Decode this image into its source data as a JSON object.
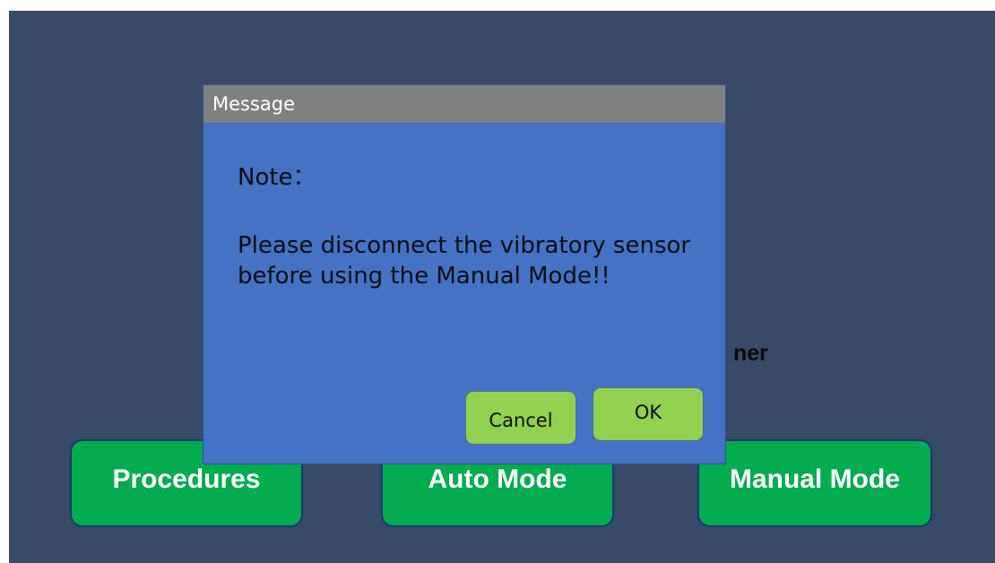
{
  "background": {
    "partial_text": "ner"
  },
  "mode_buttons": {
    "procedures": "Procedures",
    "auto": "Auto Mode",
    "manual": "Manual Mode"
  },
  "dialog": {
    "title": "Message",
    "note_label": "Note：",
    "message": "Please disconnect the vibratory sensor before using the Manual Mode!!",
    "cancel_label": "Cancel",
    "ok_label": "OK"
  },
  "colors": {
    "screen_background": "#374a68",
    "dialog_body": "#4472c4",
    "dialog_titlebar": "#808080",
    "mode_button": "#03ac4e",
    "dialog_button": "#92d050"
  }
}
